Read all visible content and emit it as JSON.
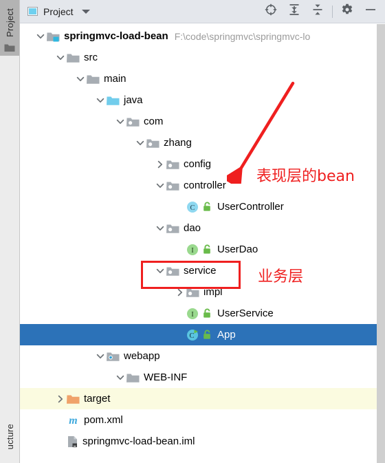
{
  "window": {
    "tool_tabs": [
      {
        "name": "project",
        "label": "Project",
        "active": true,
        "icon": "folder-icon"
      },
      {
        "name": "structure",
        "label": "ucture",
        "active": false
      }
    ]
  },
  "toolbar": {
    "title": "Project",
    "view_icon": "project-view-icon",
    "dropdown_icon": "chevron-down-icon",
    "buttons": [
      {
        "name": "scroll-from-source-button",
        "icon": "crosshair-target-icon",
        "tooltip": "Select Opened File"
      },
      {
        "name": "expand-all-button",
        "icon": "expand-all-icon",
        "tooltip": "Expand All"
      },
      {
        "name": "collapse-all-button",
        "icon": "collapse-all-icon",
        "tooltip": "Collapse All"
      },
      {
        "name": "settings-button",
        "icon": "gear-icon",
        "tooltip": "Settings"
      },
      {
        "name": "minimize-button",
        "icon": "minimize-icon",
        "tooltip": "Hide"
      }
    ]
  },
  "tree": {
    "rows": [
      {
        "id": "springmvc-load-bean",
        "label": "springmvc-load-bean",
        "path_text": "F:\\code\\springmvc\\springmvc-lo",
        "indent": 0,
        "twisty": "expanded",
        "icon": "module-folder-icon",
        "bold": true,
        "state": "normal"
      },
      {
        "id": "src",
        "label": "src",
        "indent": 1,
        "twisty": "expanded",
        "icon": "folder-icon",
        "bold": false,
        "state": "normal"
      },
      {
        "id": "main",
        "label": "main",
        "indent": 2,
        "twisty": "expanded",
        "icon": "folder-icon",
        "bold": false,
        "state": "normal"
      },
      {
        "id": "java",
        "label": "java",
        "indent": 3,
        "twisty": "expanded",
        "icon": "source-folder-icon",
        "bold": false,
        "state": "normal"
      },
      {
        "id": "com",
        "label": "com",
        "indent": 4,
        "twisty": "expanded",
        "icon": "package-folder-icon",
        "bold": false,
        "state": "normal"
      },
      {
        "id": "zhang",
        "label": "zhang",
        "indent": 5,
        "twisty": "expanded",
        "icon": "package-folder-icon",
        "bold": false,
        "state": "normal"
      },
      {
        "id": "config",
        "label": "config",
        "indent": 6,
        "twisty": "collapsed",
        "icon": "package-folder-icon",
        "bold": false,
        "state": "normal"
      },
      {
        "id": "controller",
        "label": "controller",
        "indent": 6,
        "twisty": "expanded",
        "icon": "package-folder-icon",
        "bold": false,
        "state": "normal"
      },
      {
        "id": "UserController",
        "label": "UserController",
        "indent": 7,
        "twisty": "none",
        "icon": "java-class-icon",
        "badge": "spring-bean-icon",
        "bold": false,
        "state": "normal"
      },
      {
        "id": "dao",
        "label": "dao",
        "indent": 6,
        "twisty": "expanded",
        "icon": "package-folder-icon",
        "bold": false,
        "state": "normal"
      },
      {
        "id": "UserDao",
        "label": "UserDao",
        "indent": 7,
        "twisty": "none",
        "icon": "java-interface-icon",
        "badge": "spring-bean-icon",
        "bold": false,
        "state": "normal"
      },
      {
        "id": "service",
        "label": "service",
        "indent": 6,
        "twisty": "expanded",
        "icon": "package-folder-icon",
        "bold": false,
        "state": "normal"
      },
      {
        "id": "impl",
        "label": "impl",
        "indent": 7,
        "twisty": "collapsed",
        "icon": "package-folder-icon",
        "bold": false,
        "state": "normal"
      },
      {
        "id": "UserService",
        "label": "UserService",
        "indent": 7,
        "twisty": "none",
        "icon": "java-interface-icon",
        "badge": "spring-bean-icon",
        "bold": false,
        "state": "normal"
      },
      {
        "id": "App",
        "label": "App",
        "indent": 7,
        "twisty": "none",
        "icon": "java-runnable-class-icon",
        "badge": "spring-bean-icon",
        "bold": false,
        "state": "selected"
      },
      {
        "id": "webapp",
        "label": "webapp",
        "indent": 3,
        "twisty": "expanded",
        "icon": "web-resource-folder-icon",
        "bold": false,
        "state": "normal"
      },
      {
        "id": "WEB-INF",
        "label": "WEB-INF",
        "indent": 4,
        "twisty": "expanded",
        "icon": "folder-icon",
        "bold": false,
        "state": "normal"
      },
      {
        "id": "target",
        "label": "target",
        "indent": 1,
        "twisty": "collapsed",
        "icon": "excluded-folder-icon",
        "bold": false,
        "state": "highlight"
      },
      {
        "id": "pom.xml",
        "label": "pom.xml",
        "indent": 1,
        "twisty": "none",
        "icon": "maven-file-icon",
        "bold": false,
        "state": "normal"
      },
      {
        "id": "springmvc-load-bean.iml",
        "label": "springmvc-load-bean.iml",
        "indent": 1,
        "twisty": "none",
        "icon": "iml-file-icon",
        "bold": false,
        "state": "normal"
      }
    ]
  },
  "annotations": {
    "accent_color": "#ef2020",
    "presentation_label": "表现层的bean",
    "business_label": "业务层",
    "arrow": "red-arrow-annotation",
    "box": "red-rectangle-annotation"
  }
}
